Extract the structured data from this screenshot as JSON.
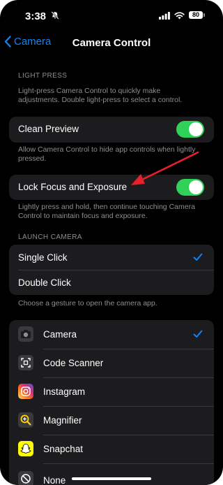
{
  "status": {
    "time": "3:38",
    "battery": "80"
  },
  "nav": {
    "back_label": "Camera",
    "title": "Camera Control"
  },
  "light_press": {
    "header": "LIGHT PRESS",
    "description": "Light-press Camera Control to quickly make adjustments. Double light-press to select a control.",
    "clean_preview": {
      "label": "Clean Preview",
      "enabled": true,
      "footer": "Allow Camera Control to hide app controls when lightly pressed."
    },
    "lock_focus": {
      "label": "Lock Focus and Exposure",
      "enabled": true,
      "footer": "Lightly press and hold, then continue touching Camera Control to maintain focus and exposure."
    }
  },
  "launch_camera": {
    "header": "LAUNCH CAMERA",
    "options": [
      {
        "label": "Single Click",
        "selected": true
      },
      {
        "label": "Double Click",
        "selected": false
      }
    ],
    "footer": "Choose a gesture to open the camera app."
  },
  "apps": [
    {
      "label": "Camera",
      "icon": "camera-app-icon",
      "selected": true
    },
    {
      "label": "Code Scanner",
      "icon": "code-scanner-icon",
      "selected": false
    },
    {
      "label": "Instagram",
      "icon": "instagram-icon",
      "selected": false
    },
    {
      "label": "Magnifier",
      "icon": "magnifier-icon",
      "selected": false
    },
    {
      "label": "Snapchat",
      "icon": "snapchat-icon",
      "selected": false
    },
    {
      "label": "None",
      "icon": "none-icon",
      "selected": false
    }
  ],
  "colors": {
    "accent": "#0a84ff",
    "toggle_on": "#30d158",
    "annotation_arrow": "#e8202a",
    "cell": "#1c1c1e",
    "secondary_text": "#8e8e93"
  }
}
